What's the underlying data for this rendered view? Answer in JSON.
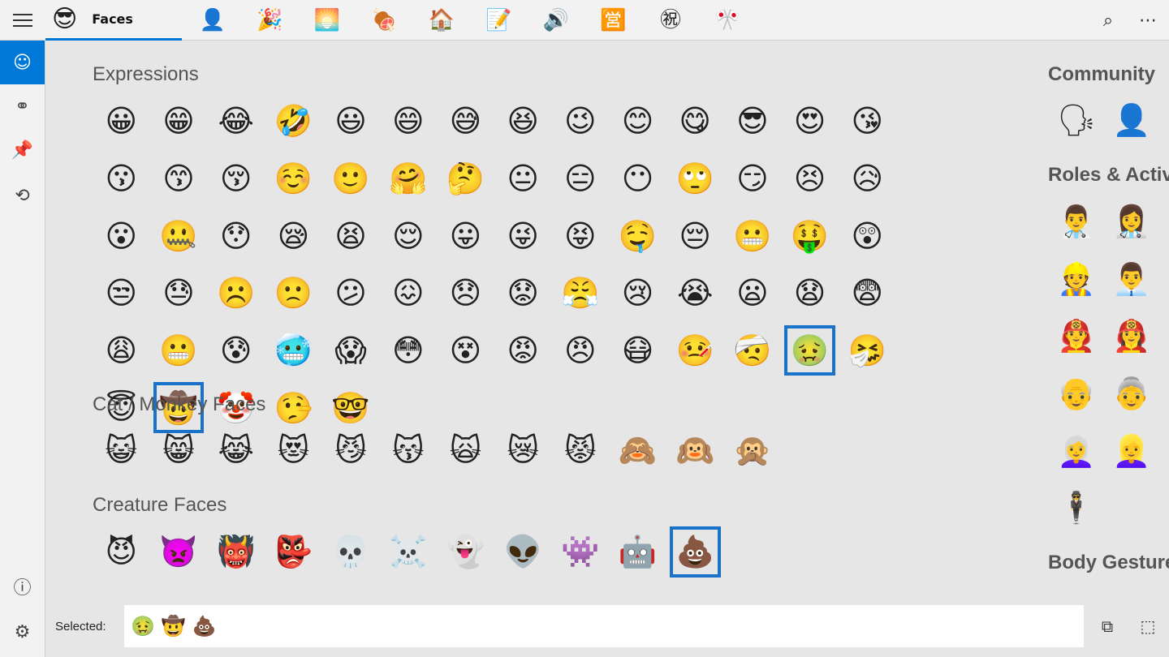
{
  "toolbar": {
    "menu_icon": "hamburger-menu-icon",
    "active_tab": {
      "icon": "😎",
      "label": "Faces"
    },
    "categories": [
      {
        "name": "people",
        "glyph": "👤"
      },
      {
        "name": "celebration",
        "glyph": "🎉"
      },
      {
        "name": "nature",
        "glyph": "🌅"
      },
      {
        "name": "food",
        "glyph": "🍖"
      },
      {
        "name": "places",
        "glyph": "🏠"
      },
      {
        "name": "objects",
        "glyph": "📝"
      },
      {
        "name": "sound",
        "glyph": "🔊"
      },
      {
        "name": "symbols",
        "glyph": "🈺"
      },
      {
        "name": "symbols2",
        "glyph": "㊗"
      },
      {
        "name": "flags",
        "glyph": "🎌"
      }
    ],
    "search_icon": "⌕",
    "more_icon": "⋯"
  },
  "rail": [
    {
      "name": "smiley-icon",
      "glyph": "☺",
      "active": true
    },
    {
      "name": "symbols-icon",
      "glyph": "⚭",
      "active": false
    },
    {
      "name": "pin-icon",
      "glyph": "📌",
      "active": false
    },
    {
      "name": "history-icon",
      "glyph": "⟲",
      "active": false
    },
    {
      "name": "info-icon",
      "glyph": "ⓘ",
      "active": false
    },
    {
      "name": "settings-icon",
      "glyph": "⚙",
      "active": false
    }
  ],
  "sections": [
    {
      "title": "Expressions",
      "emojis": [
        "😀",
        "😁",
        "😂",
        "🤣",
        "😃",
        "😄",
        "😅",
        "😆",
        "😉",
        "😊",
        "😋",
        "😎",
        "😍",
        "😘",
        "😗",
        "😙",
        "😚",
        "☺️",
        "🙂",
        "🤗",
        "🤔",
        "😐",
        "😑",
        "😶",
        "🙄",
        "😏",
        "😣",
        "😥",
        "😮",
        "🤐",
        "😯",
        "😪",
        "😫",
        "😌",
        "😛",
        "😜",
        "😝",
        "🤤",
        "😔",
        "😬",
        "🤑",
        "😲",
        "😒",
        "😓",
        "☹️",
        "🙁",
        "😕",
        "😖",
        "😞",
        "😟",
        "😤",
        "😢",
        "😭",
        "😦",
        "😧",
        "😨",
        "😩",
        "😬",
        "😰",
        "🥶",
        "😱",
        "😳",
        "😵",
        "😡",
        "😠",
        "😷",
        "🤒",
        "🤕",
        "🤢",
        "🤧",
        "😇",
        "🤠",
        "🤡",
        "🤥",
        "🤓"
      ],
      "selected": [
        68,
        71
      ]
    },
    {
      "title": "Cat / Monkey Faces",
      "emojis": [
        "😺",
        "😸",
        "😹",
        "😻",
        "😼",
        "😽",
        "🙀",
        "😿",
        "😾",
        "🙈",
        "🙉",
        "🙊"
      ],
      "selected": []
    },
    {
      "title": "Creature Faces",
      "emojis": [
        "😈",
        "👿",
        "👹",
        "👺",
        "💀",
        "☠️",
        "👻",
        "👽",
        "👾",
        "🤖",
        "💩"
      ],
      "selected": [
        10
      ]
    }
  ],
  "right_sections": [
    {
      "title": "Community",
      "emojis": [
        "🗣",
        "👤"
      ]
    },
    {
      "title": "Roles & Activit",
      "emojis": [
        "👨‍⚕️",
        "👩‍⚕️",
        "👷",
        "👨‍💼",
        "👨‍🚒",
        "👩‍🚒",
        "👴",
        "👵",
        "👩‍🦳",
        "👱‍♀️",
        "🕴"
      ]
    },
    {
      "title": "Body Gesture",
      "emojis": []
    }
  ],
  "selected_bar": {
    "label": "Selected:",
    "emojis": [
      "🤢",
      "🤠",
      "💩"
    ],
    "copy_icon": "⧉",
    "insert_icon": "⬚"
  }
}
